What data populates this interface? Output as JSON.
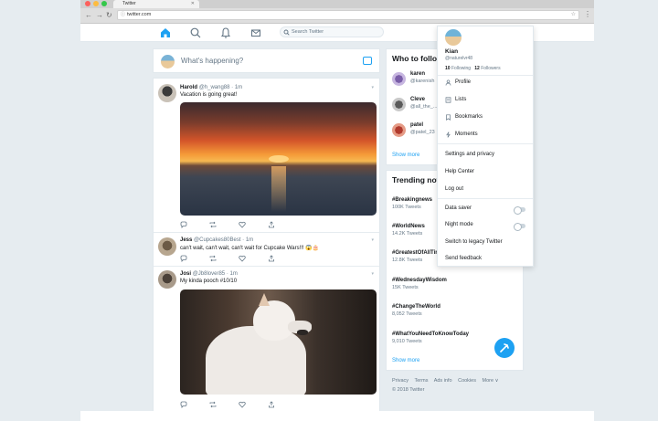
{
  "browser": {
    "tab_title": "Twitter",
    "url": "twitter.com"
  },
  "nav": {
    "search_placeholder": "Search Twitter"
  },
  "composer": {
    "placeholder": "What's happening?"
  },
  "tweets": [
    {
      "name": "Harold",
      "handle": "@h_wang88",
      "time": "· 1m",
      "text": "Vacation is going great!"
    },
    {
      "name": "Jess",
      "handle": "@Cupcakes80Best",
      "time": "· 1m",
      "text": "can't wait, can't wait, can't wait for Cupcake Wars!!! 😱🎂"
    },
    {
      "name": "Josi",
      "handle": "@Jb8lover85",
      "time": "· 1m",
      "text": "My kinda pooch #10/10"
    }
  ],
  "who_to_follow": {
    "title": "Who to follow",
    "people": [
      {
        "name": "karen",
        "handle": "@karenish"
      },
      {
        "name": "Cleve",
        "handle": "@all_the_..."
      },
      {
        "name": "patel",
        "handle": "@patel_23"
      }
    ],
    "show_more": "Show more"
  },
  "trends": {
    "title": "Trending now",
    "items": [
      {
        "tag": "#Breakingnews",
        "count": "100K Tweets"
      },
      {
        "tag": "#WorldNews",
        "count": "14.2K Tweets"
      },
      {
        "tag": "#GreatestOfAllTime",
        "count": "12.8K Tweets"
      },
      {
        "tag": "#WednesdayWisdom",
        "count": "15K Tweets"
      },
      {
        "tag": "#ChangeTheWorld",
        "count": "8,052 Tweets"
      },
      {
        "tag": "#WhatYouNeedToKnowToday",
        "count": "9,010 Tweets"
      }
    ],
    "show_more": "Show more"
  },
  "footer": {
    "links": [
      "Privacy",
      "Terms",
      "Ads info",
      "Cookies",
      "More ∨"
    ],
    "copyright": "© 2018 Twitter"
  },
  "account_menu": {
    "name": "Kian",
    "handle": "@naturelvr48",
    "following_count": "10",
    "following_label": "Following",
    "followers_count": "12",
    "followers_label": "Followers",
    "items": [
      "Profile",
      "Lists",
      "Bookmarks",
      "Moments"
    ],
    "items2": [
      "Settings and privacy",
      "Help Center",
      "Log out"
    ],
    "toggles": [
      "Data saver",
      "Night mode"
    ],
    "items3": [
      "Switch to legacy Twitter",
      "Send feedback"
    ]
  },
  "colors": {
    "brand": "#1da1f2",
    "background": "#e6ecf0",
    "secondary_text": "#657786"
  }
}
